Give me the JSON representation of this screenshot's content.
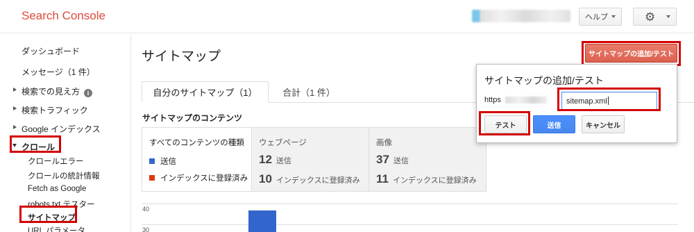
{
  "header": {
    "logo": "Search Console",
    "help_label": "ヘルプ"
  },
  "sidebar": {
    "dashboard": "ダッシュボード",
    "messages": "メッセージ（1 件）",
    "search_appearance": "検索での見え方",
    "search_traffic": "検索トラフィック",
    "google_index": "Google インデックス",
    "crawl": "クロール",
    "crawl_sub": [
      "クロールエラー",
      "クロールの統計情報",
      "Fetch as Google",
      "robots.txt テスター",
      "サイトマップ",
      "URL パラメータ"
    ]
  },
  "main": {
    "title": "サイトマップ",
    "add_test_button": "サイトマップの追加/テスト",
    "tabs": [
      "自分のサイトマップ（1）",
      "合計（1 件）"
    ],
    "contents_title": "サイトマップのコンテンツ",
    "panel_all": {
      "heading": "すべてのコンテンツの種類",
      "legend_submitted": "送信",
      "legend_indexed": "インデックスに登録済み"
    },
    "panel_web": {
      "heading": "ウェブページ",
      "submitted_num": "12",
      "submitted_label": "送信",
      "indexed_num": "10",
      "indexed_label": "インデックスに登録済み"
    },
    "panel_image": {
      "heading": "画像",
      "submitted_num": "37",
      "submitted_label": "送信",
      "indexed_num": "11",
      "indexed_label": "インデックスに登録済み"
    },
    "chart_ticks": [
      "40",
      "30"
    ]
  },
  "popup": {
    "title": "サイトマップの追加/テスト",
    "prefix": "https",
    "input_value": "sitemap.xml",
    "test_label": "テスト",
    "send_label": "送信",
    "cancel_label": "キャンセル"
  },
  "colors": {
    "brand": "#dd4b39",
    "submitted": "#3366cc",
    "indexed": "#dc3912",
    "highlight": "#d40000"
  }
}
